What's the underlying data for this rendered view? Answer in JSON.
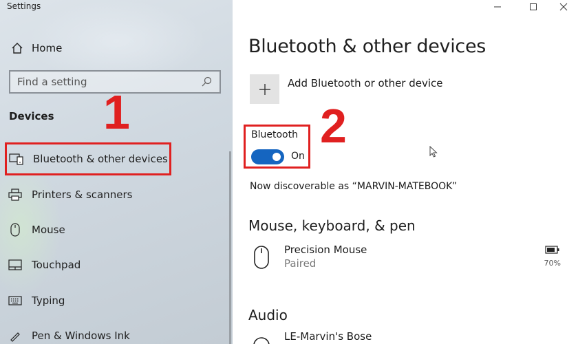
{
  "window": {
    "title": "Settings",
    "controls": {
      "minimize": "minimize-icon",
      "maximize": "maximize-icon",
      "close": "close-icon"
    }
  },
  "sidebar": {
    "home_label": "Home",
    "search_placeholder": "Find a setting",
    "section_title": "Devices",
    "items": [
      {
        "label": "Bluetooth & other devices",
        "icon": "bluetooth-devices-icon",
        "active": true
      },
      {
        "label": "Printers & scanners",
        "icon": "printer-icon"
      },
      {
        "label": "Mouse",
        "icon": "mouse-icon"
      },
      {
        "label": "Touchpad",
        "icon": "touchpad-icon"
      },
      {
        "label": "Typing",
        "icon": "keyboard-icon"
      },
      {
        "label": "Pen & Windows Ink",
        "icon": "pen-icon"
      }
    ]
  },
  "annotations": {
    "marker1": "1",
    "marker2": "2",
    "color": "#e02020"
  },
  "main": {
    "title": "Bluetooth & other devices",
    "add_device_label": "Add Bluetooth or other device",
    "bluetooth_label": "Bluetooth",
    "bluetooth_state": "On",
    "bluetooth_on": true,
    "discoverable_text": "Now discoverable as “MARVIN-MATEBOOK”",
    "sections": {
      "mouse_keyboard_pen": "Mouse, keyboard, & pen",
      "audio": "Audio"
    },
    "devices": [
      {
        "name": "Precision Mouse",
        "status": "Paired",
        "battery": "70%",
        "icon": "mouse-icon"
      },
      {
        "name": "LE-Marvin's Bose",
        "icon": "headphones-icon"
      }
    ]
  },
  "colors": {
    "accent": "#1565c0",
    "highlight": "#e02020"
  }
}
